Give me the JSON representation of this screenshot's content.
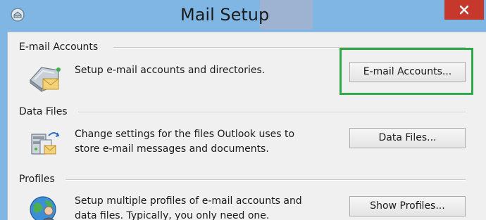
{
  "window": {
    "title": "Mail Setup",
    "app_icon": "outlook-mail-icon",
    "close_icon": "close-icon"
  },
  "sections": {
    "email_accounts": {
      "label": "E-mail Accounts",
      "icon": "email-accounts-icon",
      "description": "Setup e-mail accounts and directories.",
      "button_label": "E-mail Accounts..."
    },
    "data_files": {
      "label": "Data Files",
      "icon": "data-files-icon",
      "description_line1": "Change settings for the files Outlook uses to",
      "description_line2": "store e-mail messages and documents.",
      "button_label": "Data Files..."
    },
    "profiles": {
      "label": "Profiles",
      "icon": "profiles-icon",
      "description_line1": "Setup multiple profiles of e-mail accounts and",
      "description_line2": "data files. Typically, you only need one.",
      "button_label": "Show Profiles..."
    }
  },
  "colors": {
    "titlebar": "#7fb6e3",
    "close_button": "#c7382c",
    "focus_highlight": "#2fa84a",
    "dialog_background": "#f0f0f0"
  }
}
